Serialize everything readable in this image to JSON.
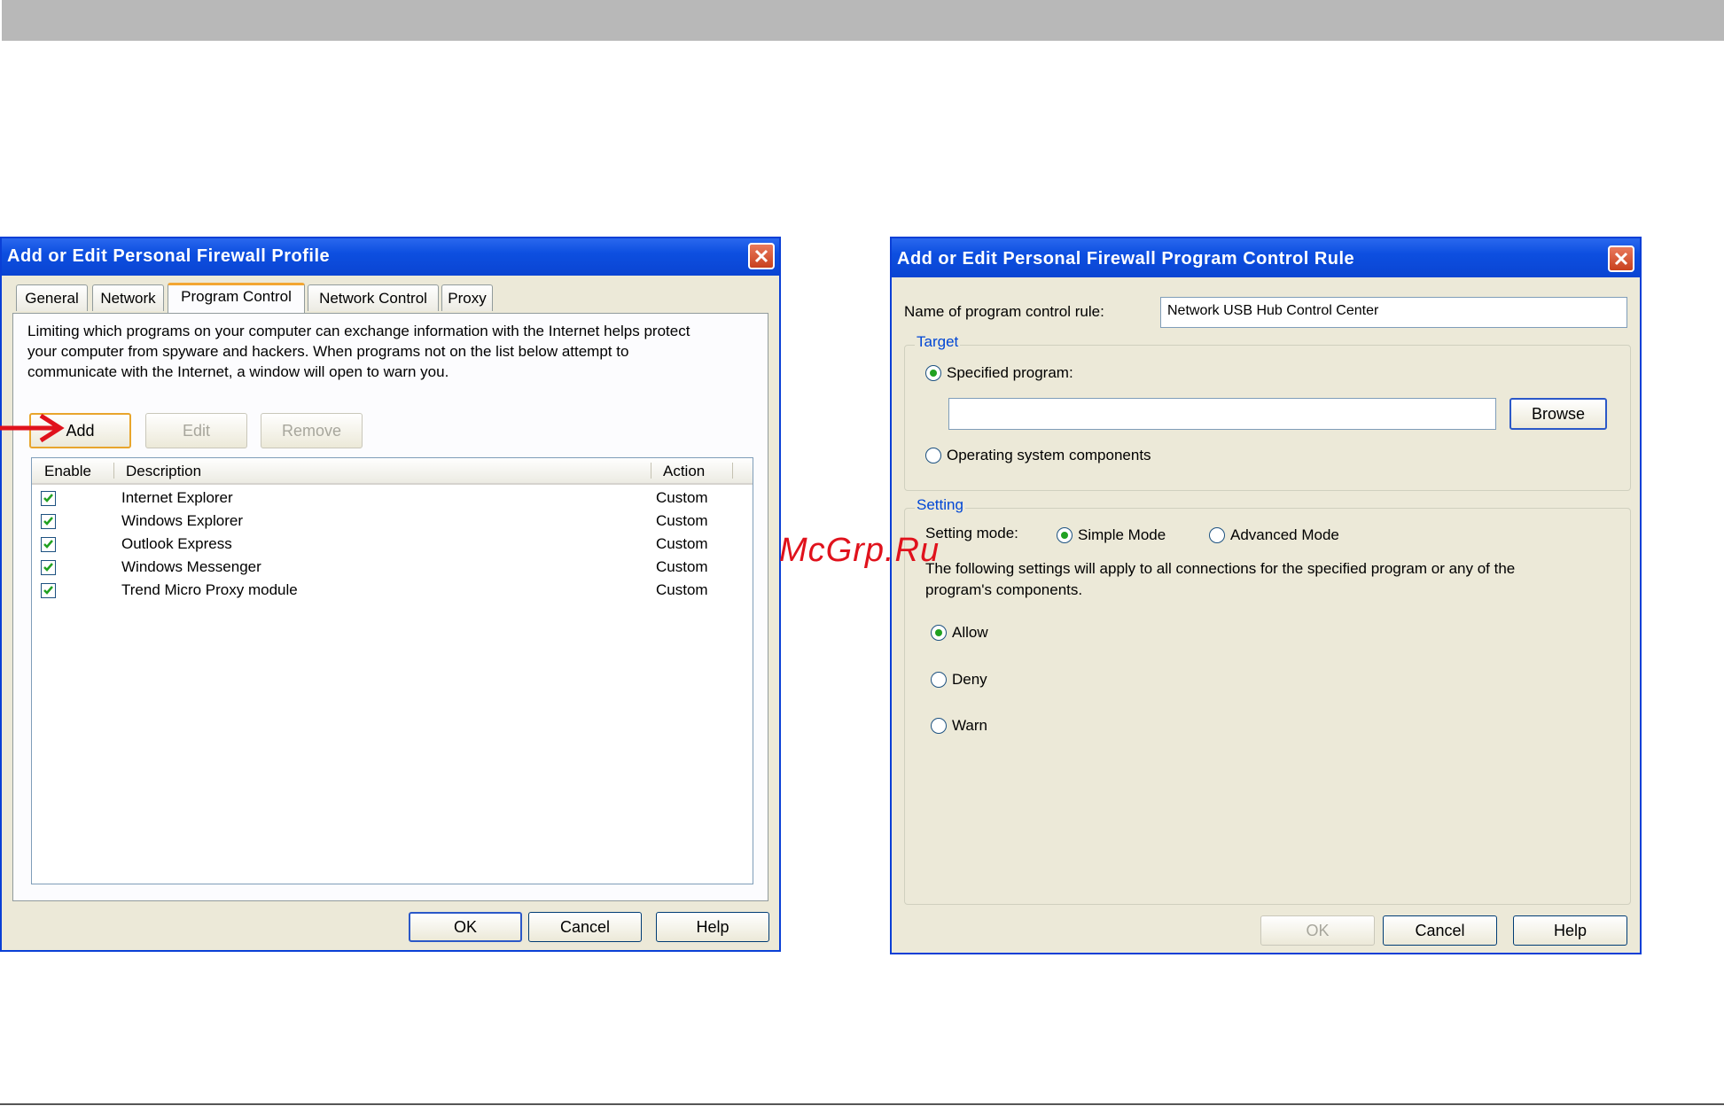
{
  "left_window": {
    "title": "Add or Edit Personal Firewall Profile",
    "tabs": [
      "General",
      "Network",
      "Program Control",
      "Network Control",
      "Proxy"
    ],
    "active_tab": "Program Control",
    "description": "Limiting which programs on your computer can exchange information with the Internet helps protect your computer from spyware and hackers. When programs not on the list below attempt to communicate with the Internet, a window will open to warn you.",
    "description_lines": [
      "Limiting which programs on your computer can exchange information with the Internet helps protect",
      "your computer from spyware and hackers. When programs not on the list below attempt to",
      "communicate with the Internet, a window will open to warn you."
    ],
    "add_label": "Add",
    "edit_label": "Edit",
    "remove_label": "Remove",
    "columns": {
      "enable": "Enable",
      "description": "Description",
      "action": "Action"
    },
    "rows": [
      {
        "enabled": true,
        "description": "Internet Explorer",
        "action": "Custom"
      },
      {
        "enabled": true,
        "description": "Windows Explorer",
        "action": "Custom"
      },
      {
        "enabled": true,
        "description": "Outlook Express",
        "action": "Custom"
      },
      {
        "enabled": true,
        "description": "Windows Messenger",
        "action": "Custom"
      },
      {
        "enabled": true,
        "description": "Trend Micro Proxy module",
        "action": "Custom"
      }
    ],
    "ok_label": "OK",
    "cancel_label": "Cancel",
    "help_label": "Help"
  },
  "right_window": {
    "title": "Add or Edit Personal Firewall Program Control Rule",
    "rule_name_label": "Name of program control rule:",
    "rule_name_value": "Network USB Hub Control Center",
    "target_title": "Target",
    "specified_program_label": "Specified program:",
    "specified_program_selected": true,
    "program_path_value": "",
    "browse_label": "Browse",
    "os_components_label": "Operating system components",
    "setting_title": "Setting",
    "setting_mode_label": "Setting mode:",
    "simple_mode_label": "Simple Mode",
    "advanced_mode_label": "Advanced Mode",
    "selected_mode": "Simple Mode",
    "info_lines": [
      "The following settings will apply to all connections for the specified program or any of the",
      "program's components."
    ],
    "allow_label": "Allow",
    "deny_label": "Deny",
    "warn_label": "Warn",
    "selected_action": "Allow",
    "ok_label": "OK",
    "cancel_label": "Cancel",
    "help_label": "Help"
  },
  "watermark": "McGrp.Ru",
  "colors": {
    "title_bar": "#0a44d2",
    "dialog_bg": "#ece9d8",
    "arrow": "#e0121c",
    "group_title": "#0046d5"
  }
}
